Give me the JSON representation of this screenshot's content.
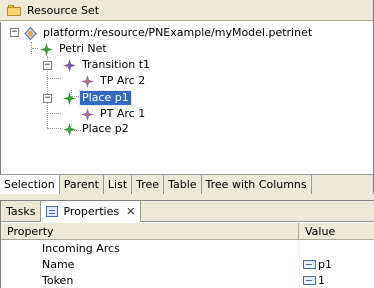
{
  "editor": {
    "title": "Resource Set",
    "tree": {
      "resource": "platform:/resource/PNExample/myModel.petrinet",
      "root": "Petri Net",
      "transition": "Transition t1",
      "tp_arc": "TP Arc 2",
      "place_p1": "Place p1",
      "pt_arc": "PT Arc 1",
      "place_p2": "Place p2"
    },
    "tabs": [
      "Selection",
      "Parent",
      "List",
      "Tree",
      "Table",
      "Tree with Columns"
    ]
  },
  "properties": {
    "tabs": {
      "tasks": "Tasks",
      "properties": "Properties",
      "close": "✕"
    },
    "columns": {
      "property": "Property",
      "value": "Value"
    },
    "rows": [
      {
        "property": "Incoming Arcs",
        "value": ""
      },
      {
        "property": "Name",
        "value": "p1"
      },
      {
        "property": "Token",
        "value": "1"
      }
    ]
  },
  "colors": {
    "selection": "#316ac5",
    "place_icon": "#3a9a3a",
    "transition_icon": "#7a5aa8"
  }
}
